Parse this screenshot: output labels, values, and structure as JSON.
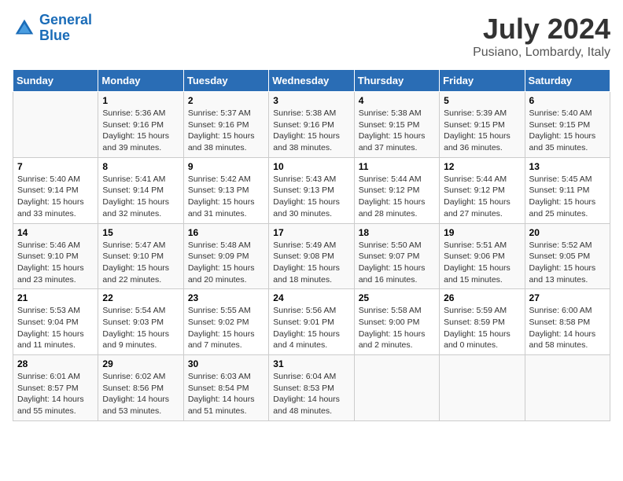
{
  "header": {
    "logo_line1": "General",
    "logo_line2": "Blue",
    "month_year": "July 2024",
    "location": "Pusiano, Lombardy, Italy"
  },
  "columns": [
    "Sunday",
    "Monday",
    "Tuesday",
    "Wednesday",
    "Thursday",
    "Friday",
    "Saturday"
  ],
  "weeks": [
    [
      {
        "day": "",
        "info": ""
      },
      {
        "day": "1",
        "info": "Sunrise: 5:36 AM\nSunset: 9:16 PM\nDaylight: 15 hours\nand 39 minutes."
      },
      {
        "day": "2",
        "info": "Sunrise: 5:37 AM\nSunset: 9:16 PM\nDaylight: 15 hours\nand 38 minutes."
      },
      {
        "day": "3",
        "info": "Sunrise: 5:38 AM\nSunset: 9:16 PM\nDaylight: 15 hours\nand 38 minutes."
      },
      {
        "day": "4",
        "info": "Sunrise: 5:38 AM\nSunset: 9:15 PM\nDaylight: 15 hours\nand 37 minutes."
      },
      {
        "day": "5",
        "info": "Sunrise: 5:39 AM\nSunset: 9:15 PM\nDaylight: 15 hours\nand 36 minutes."
      },
      {
        "day": "6",
        "info": "Sunrise: 5:40 AM\nSunset: 9:15 PM\nDaylight: 15 hours\nand 35 minutes."
      }
    ],
    [
      {
        "day": "7",
        "info": "Sunrise: 5:40 AM\nSunset: 9:14 PM\nDaylight: 15 hours\nand 33 minutes."
      },
      {
        "day": "8",
        "info": "Sunrise: 5:41 AM\nSunset: 9:14 PM\nDaylight: 15 hours\nand 32 minutes."
      },
      {
        "day": "9",
        "info": "Sunrise: 5:42 AM\nSunset: 9:13 PM\nDaylight: 15 hours\nand 31 minutes."
      },
      {
        "day": "10",
        "info": "Sunrise: 5:43 AM\nSunset: 9:13 PM\nDaylight: 15 hours\nand 30 minutes."
      },
      {
        "day": "11",
        "info": "Sunrise: 5:44 AM\nSunset: 9:12 PM\nDaylight: 15 hours\nand 28 minutes."
      },
      {
        "day": "12",
        "info": "Sunrise: 5:44 AM\nSunset: 9:12 PM\nDaylight: 15 hours\nand 27 minutes."
      },
      {
        "day": "13",
        "info": "Sunrise: 5:45 AM\nSunset: 9:11 PM\nDaylight: 15 hours\nand 25 minutes."
      }
    ],
    [
      {
        "day": "14",
        "info": "Sunrise: 5:46 AM\nSunset: 9:10 PM\nDaylight: 15 hours\nand 23 minutes."
      },
      {
        "day": "15",
        "info": "Sunrise: 5:47 AM\nSunset: 9:10 PM\nDaylight: 15 hours\nand 22 minutes."
      },
      {
        "day": "16",
        "info": "Sunrise: 5:48 AM\nSunset: 9:09 PM\nDaylight: 15 hours\nand 20 minutes."
      },
      {
        "day": "17",
        "info": "Sunrise: 5:49 AM\nSunset: 9:08 PM\nDaylight: 15 hours\nand 18 minutes."
      },
      {
        "day": "18",
        "info": "Sunrise: 5:50 AM\nSunset: 9:07 PM\nDaylight: 15 hours\nand 16 minutes."
      },
      {
        "day": "19",
        "info": "Sunrise: 5:51 AM\nSunset: 9:06 PM\nDaylight: 15 hours\nand 15 minutes."
      },
      {
        "day": "20",
        "info": "Sunrise: 5:52 AM\nSunset: 9:05 PM\nDaylight: 15 hours\nand 13 minutes."
      }
    ],
    [
      {
        "day": "21",
        "info": "Sunrise: 5:53 AM\nSunset: 9:04 PM\nDaylight: 15 hours\nand 11 minutes."
      },
      {
        "day": "22",
        "info": "Sunrise: 5:54 AM\nSunset: 9:03 PM\nDaylight: 15 hours\nand 9 minutes."
      },
      {
        "day": "23",
        "info": "Sunrise: 5:55 AM\nSunset: 9:02 PM\nDaylight: 15 hours\nand 7 minutes."
      },
      {
        "day": "24",
        "info": "Sunrise: 5:56 AM\nSunset: 9:01 PM\nDaylight: 15 hours\nand 4 minutes."
      },
      {
        "day": "25",
        "info": "Sunrise: 5:58 AM\nSunset: 9:00 PM\nDaylight: 15 hours\nand 2 minutes."
      },
      {
        "day": "26",
        "info": "Sunrise: 5:59 AM\nSunset: 8:59 PM\nDaylight: 15 hours\nand 0 minutes."
      },
      {
        "day": "27",
        "info": "Sunrise: 6:00 AM\nSunset: 8:58 PM\nDaylight: 14 hours\nand 58 minutes."
      }
    ],
    [
      {
        "day": "28",
        "info": "Sunrise: 6:01 AM\nSunset: 8:57 PM\nDaylight: 14 hours\nand 55 minutes."
      },
      {
        "day": "29",
        "info": "Sunrise: 6:02 AM\nSunset: 8:56 PM\nDaylight: 14 hours\nand 53 minutes."
      },
      {
        "day": "30",
        "info": "Sunrise: 6:03 AM\nSunset: 8:54 PM\nDaylight: 14 hours\nand 51 minutes."
      },
      {
        "day": "31",
        "info": "Sunrise: 6:04 AM\nSunset: 8:53 PM\nDaylight: 14 hours\nand 48 minutes."
      },
      {
        "day": "",
        "info": ""
      },
      {
        "day": "",
        "info": ""
      },
      {
        "day": "",
        "info": ""
      }
    ]
  ]
}
